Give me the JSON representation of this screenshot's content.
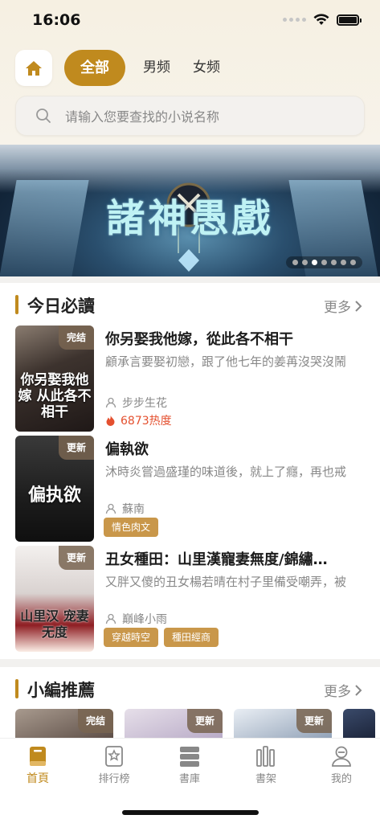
{
  "status": {
    "time": "16:06"
  },
  "header": {
    "tabs": [
      {
        "label": "全部"
      },
      {
        "label": "男频"
      },
      {
        "label": "女频"
      }
    ]
  },
  "search": {
    "placeholder": "请输入您要查找的小说名称"
  },
  "banner": {
    "title": "諸神愚戲",
    "pages": 7,
    "active_page": 3
  },
  "today": {
    "title": "今日必讀",
    "more": "更多",
    "books": [
      {
        "badge": "完结",
        "cover_text": "你另娶我他嫁 从此各不相干",
        "title": "你另娶我他嫁，從此各不相干",
        "desc": "顧承言要娶初戀，跟了他七年的姜苒沒哭沒鬧",
        "author": "步步生花",
        "heat": "6873热度"
      },
      {
        "badge": "更新",
        "cover_text": "偏执欲",
        "title": "偏執欲",
        "desc": "沐時炎嘗過盛瑾的味道後，就上了癮，再也戒",
        "author": "蘇南",
        "tags": [
          "情色肉文"
        ]
      },
      {
        "badge": "更新",
        "cover_text": "山里汉 宠妻无度",
        "title": "丑女種田：山里漢寵妻無度/錦繡…",
        "desc": "又胖又傻的丑女楊若晴在村子里備受嘲弄，被",
        "author": "巔峰小雨",
        "tags": [
          "穿越時空",
          "種田經商"
        ]
      }
    ]
  },
  "editor": {
    "title": "小編推薦",
    "more": "更多",
    "badges": [
      "完结",
      "更新",
      "更新"
    ]
  },
  "tabbar": {
    "items": [
      {
        "label": "首頁",
        "icon": "book-icon"
      },
      {
        "label": "排行榜",
        "icon": "ranking-icon"
      },
      {
        "label": "書庫",
        "icon": "library-icon"
      },
      {
        "label": "書架",
        "icon": "bookshelf-icon"
      },
      {
        "label": "我的",
        "icon": "profile-icon"
      }
    ]
  },
  "colors": {
    "accent": "#c08a1e",
    "heat": "#e4502f",
    "tag": "#c9974a"
  }
}
